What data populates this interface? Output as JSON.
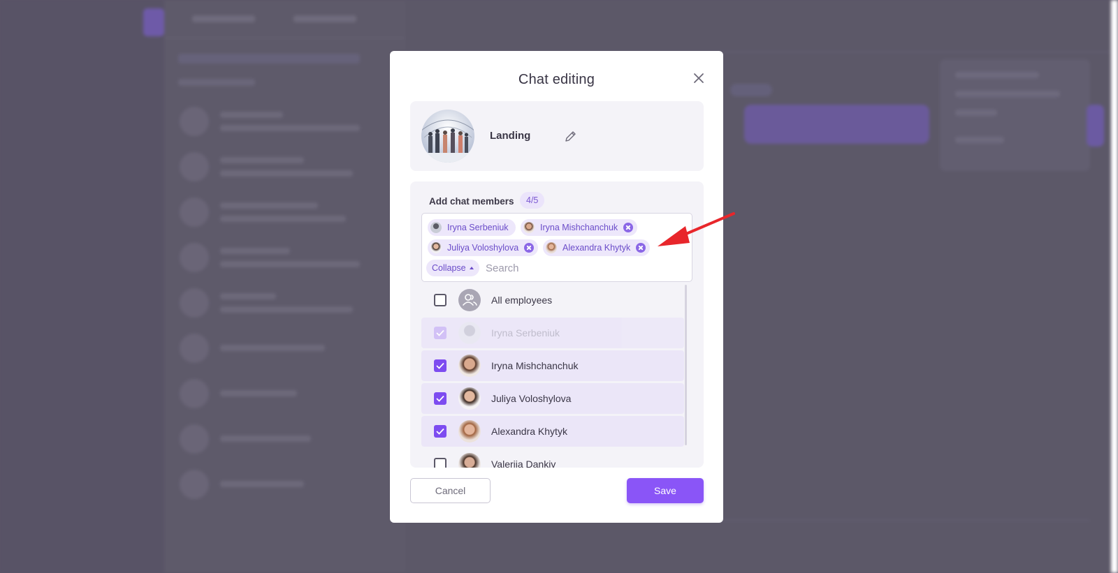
{
  "modal": {
    "title": "Chat editing",
    "chat_name": "Landing",
    "members_title": "Add chat members",
    "members_count": "4/5",
    "tags": [
      {
        "label": "Iryna Serbeniuk"
      },
      {
        "label": "Iryna Mishchanchuk"
      },
      {
        "label": "Juliya Voloshylova"
      },
      {
        "label": "Alexandra Khytyk"
      }
    ],
    "collapse_label": "Collapse",
    "search_placeholder": "Search",
    "list": [
      {
        "name": "All employees",
        "checked": false
      },
      {
        "name": "Iryna Serbeniuk",
        "checked": true,
        "disabled": true
      },
      {
        "name": "Iryna Mishchanchuk",
        "checked": true
      },
      {
        "name": "Juliya Voloshylova",
        "checked": true
      },
      {
        "name": "Alexandra Khytyk",
        "checked": true
      },
      {
        "name": "Valeriia Dankiv",
        "checked": false
      }
    ],
    "cancel_label": "Cancel",
    "save_label": "Save"
  },
  "colors": {
    "accent": "#8a55f7",
    "tag_bg": "#ede7fb",
    "overlay": "#5a5467",
    "annotation_arrow": "#e8262b"
  },
  "icons": [
    "close-icon",
    "pencil-icon",
    "remove-tag-icon",
    "caret-up-icon",
    "group-icon",
    "checkmark-icon",
    "annotation-arrow"
  ]
}
